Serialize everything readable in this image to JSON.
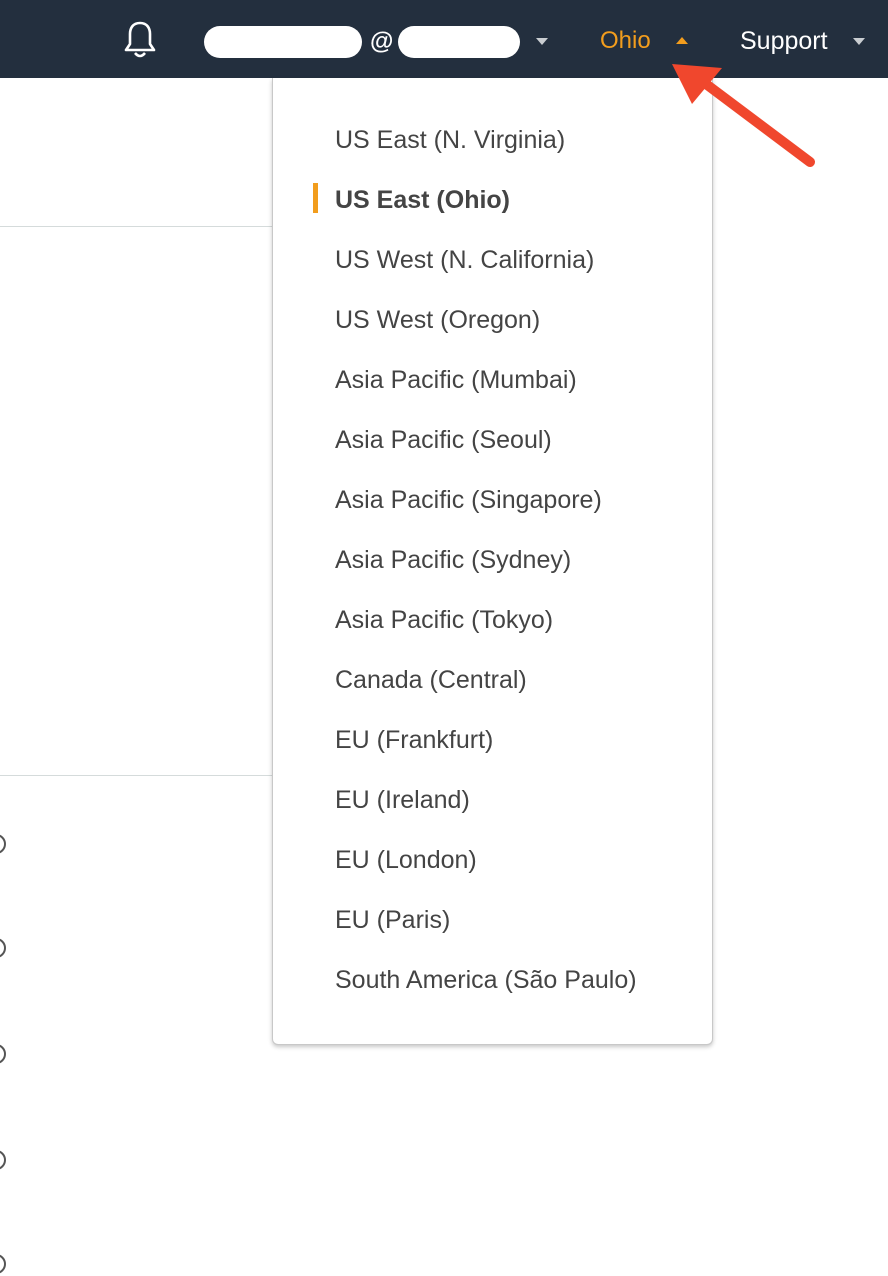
{
  "topbar": {
    "account_at": "@",
    "region_label": "Ohio",
    "support_label": "Support"
  },
  "region_menu": {
    "items": [
      "US East (N. Virginia)",
      "US East (Ohio)",
      "US West (N. California)",
      "US West (Oregon)",
      "Asia Pacific (Mumbai)",
      "Asia Pacific (Seoul)",
      "Asia Pacific (Singapore)",
      "Asia Pacific (Sydney)",
      "Asia Pacific (Tokyo)",
      "Canada (Central)",
      "EU (Frankfurt)",
      "EU (Ireland)",
      "EU (London)",
      "EU (Paris)",
      "South America (São Paulo)"
    ],
    "selected_index": 1
  },
  "colors": {
    "navbar": "#232f3e",
    "accent": "#f29d1d",
    "annotation_arrow": "#f0472d"
  },
  "icons": [
    "bell-icon",
    "chevron-down-icon",
    "chevron-up-icon",
    "annotation-arrow"
  ]
}
